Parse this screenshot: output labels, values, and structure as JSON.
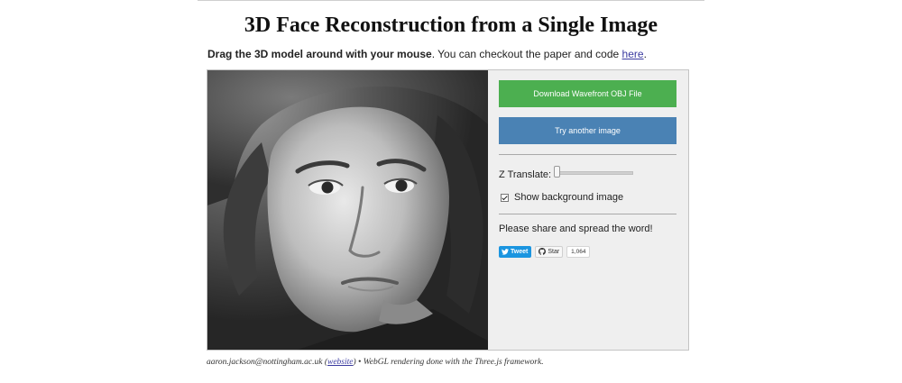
{
  "page": {
    "title": "3D Face Reconstruction from a Single Image"
  },
  "intro": {
    "bold": "Drag the 3D model around with your mouse",
    "rest": ". You can checkout the paper and code ",
    "link": "here",
    "end": "."
  },
  "controls": {
    "download_label": "Download Wavefront OBJ File",
    "download_color": "#4caf50",
    "try_label": "Try another image",
    "try_color": "#4a82b4",
    "z_translate_label": "Z Translate:",
    "z_translate_value": 0,
    "show_bg_label": "Show background image",
    "show_bg_checked": true,
    "share_text": "Please share and spread the word!"
  },
  "social": {
    "tweet_label": "Tweet",
    "star_label": "Star",
    "star_count": "1,064"
  },
  "footer": {
    "email": "aaron.jackson@nottingham.ac.uk",
    "open_paren": " (",
    "website_link": "website",
    "rest": ") • WebGL rendering done with the Three.js framework."
  }
}
